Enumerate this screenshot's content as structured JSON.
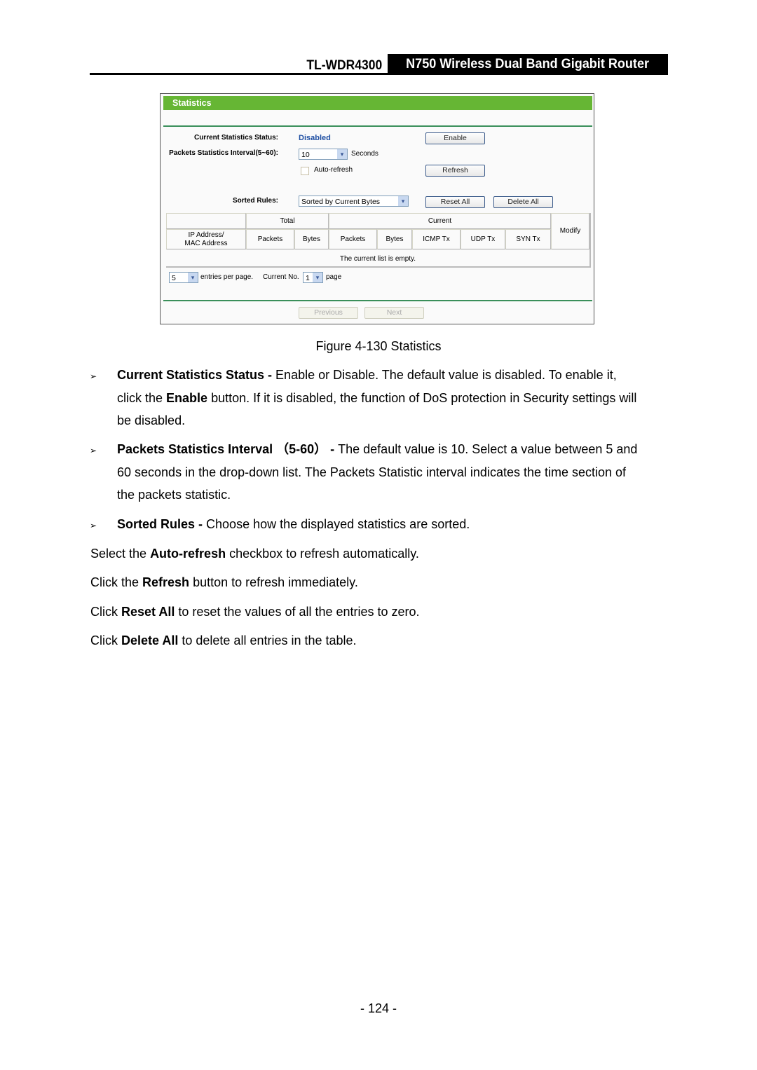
{
  "header": {
    "model": "TL-WDR4300",
    "product": "N750 Wireless Dual Band Gigabit Router"
  },
  "screenshot": {
    "title": "Statistics",
    "status_label": "Current Statistics Status:",
    "status_value": "Disabled",
    "enable_button": "Enable",
    "interval_label": "Packets Statistics Interval(5~60):",
    "interval_value": "10",
    "interval_unit": "Seconds",
    "autorefresh_label": "Auto-refresh",
    "autorefresh_checked": false,
    "refresh_button": "Refresh",
    "sorted_label": "Sorted Rules:",
    "sorted_value": "Sorted by Current Bytes",
    "reset_all_button": "Reset All",
    "delete_all_button": "Delete All",
    "table": {
      "group_total": "Total",
      "group_current": "Current",
      "col_address_line1": "IP Address/",
      "col_address_line2": "MAC Address",
      "columns": [
        "Packets",
        "Bytes",
        "Packets",
        "Bytes",
        "ICMP Tx",
        "UDP Tx",
        "SYN Tx"
      ],
      "col_modify": "Modify",
      "empty_message": "The current list is empty."
    },
    "entries_value": "5",
    "entries_label": "entries per page.",
    "current_no_label": "Current No.",
    "current_no_value": "1",
    "page_label": "page",
    "previous_button": "Previous",
    "next_button": "Next",
    "arrow_glyph": "▾"
  },
  "caption": "Figure 4-130 Statistics",
  "bullet_glyph": "➢",
  "bullets": [
    {
      "term": "Current Statistics Status -",
      "lines": [
        " Enable or Disable. The default value is disabled. To enable it,",
        "click the ",
        "Enable",
        " button. If it is disabled, the function of DoS protection in Security settings will",
        "be disabled."
      ]
    },
    {
      "term": "Packets Statistics Interval （5-60） -",
      "lines": [
        " The default value is 10. Select a value between 5 and",
        "60 seconds in the drop-down list. The Packets Statistic interval indicates the time section of",
        "the packets statistic."
      ]
    },
    {
      "term": "Sorted Rules -",
      "lines": [
        " Choose how the displayed statistics are sorted."
      ]
    }
  ],
  "notes": [
    {
      "pre": "Select the ",
      "bold": "Auto-refresh",
      "post": " checkbox to refresh automatically."
    },
    {
      "pre": "Click the ",
      "bold": "Refresh",
      "post": " button to refresh immediately."
    },
    {
      "pre": "Click ",
      "bold": "Reset All",
      "post": " to reset the values of all the entries to zero."
    },
    {
      "pre": "Click ",
      "bold": "Delete All",
      "post": " to delete all entries in the table."
    }
  ],
  "page_number": "- 124 -"
}
